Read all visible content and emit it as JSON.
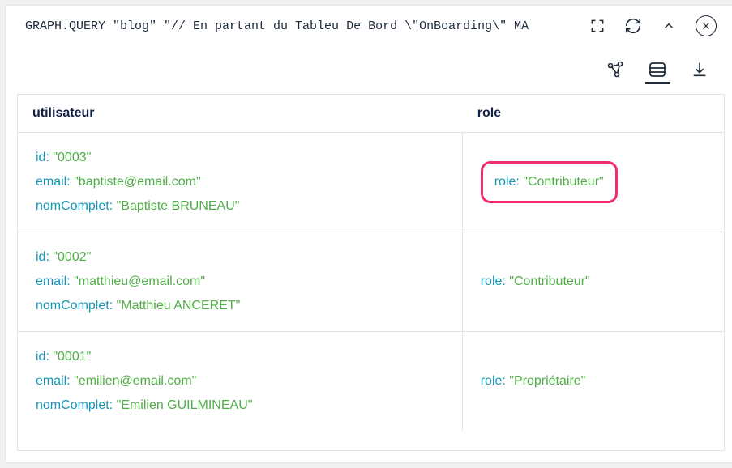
{
  "query": "GRAPH.QUERY \"blog\" \"// En partant du Tableu De Bord \\\"OnBoarding\\\" MA",
  "columns": {
    "user": "utilisateur",
    "role": "role"
  },
  "keys": {
    "id": "id",
    "email": "email",
    "nomComplet": "nomComplet",
    "role": "role"
  },
  "rows": [
    {
      "user": {
        "id": "\"0003\"",
        "email": "\"baptiste@email.com\"",
        "nomComplet": "\"Baptiste BRUNEAU\""
      },
      "role": {
        "role": "\"Contributeur\""
      },
      "highlight": true
    },
    {
      "user": {
        "id": "\"0002\"",
        "email": "\"matthieu@email.com\"",
        "nomComplet": "\"Matthieu ANCERET\""
      },
      "role": {
        "role": "\"Contributeur\""
      },
      "highlight": false
    },
    {
      "user": {
        "id": "\"0001\"",
        "email": "\"emilien@email.com\"",
        "nomComplet": "\"Emilien GUILMINEAU\""
      },
      "role": {
        "role": "\"Propriétaire\""
      },
      "highlight": false
    }
  ]
}
